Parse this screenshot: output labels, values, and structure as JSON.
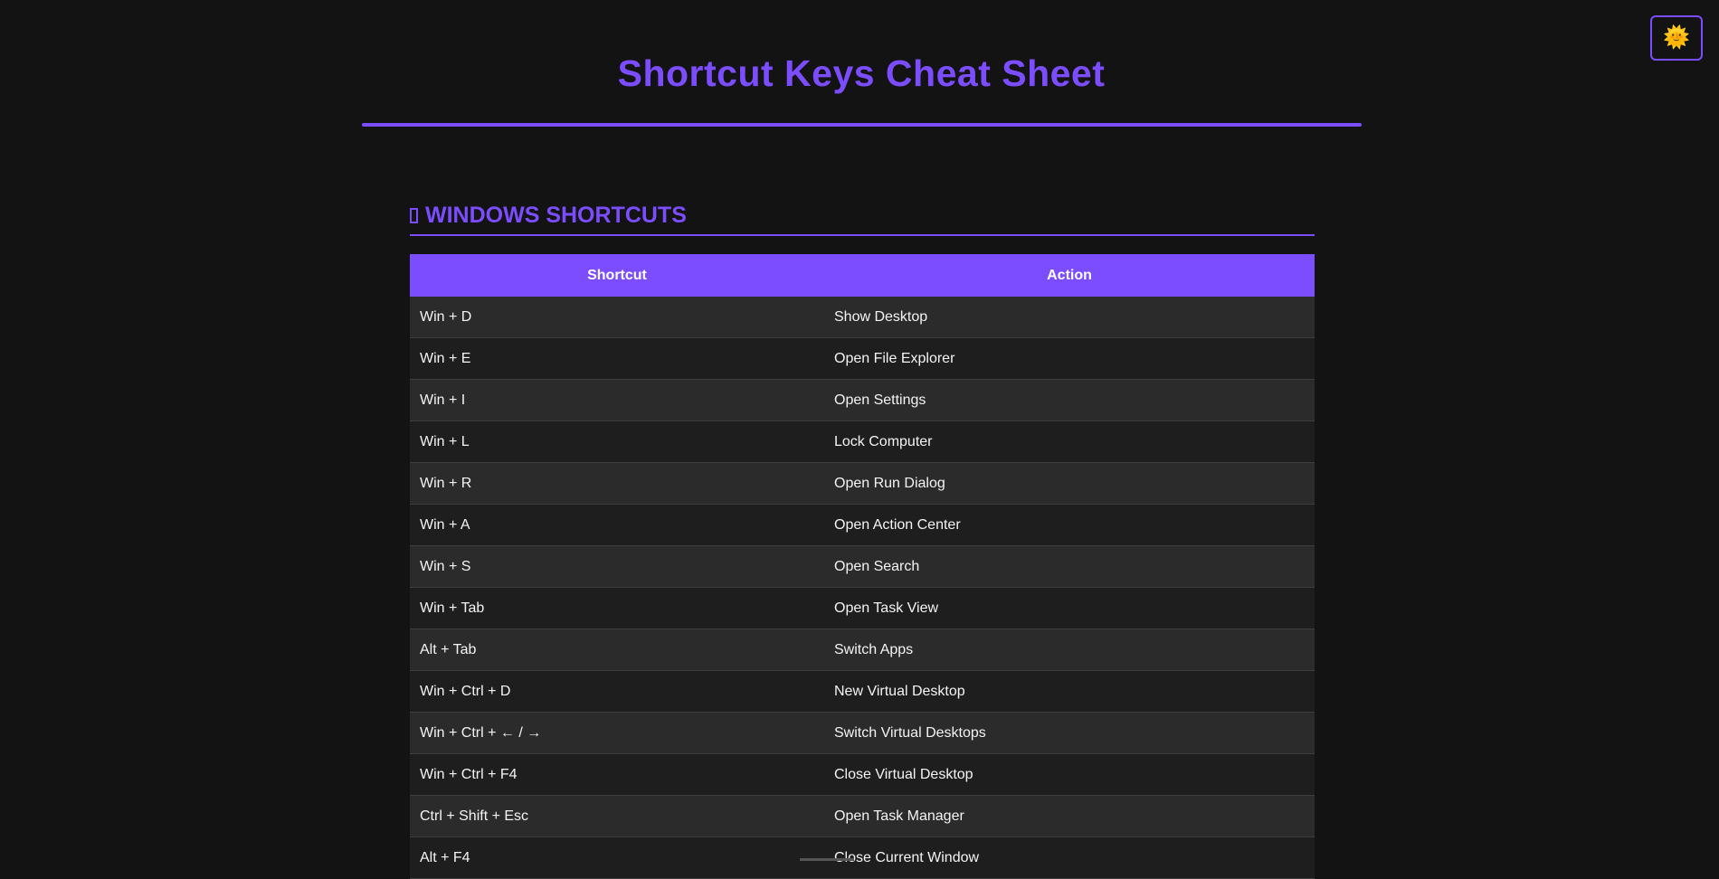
{
  "header": {
    "title": "Shortcut Keys Cheat Sheet",
    "theme_toggle_icon": "sun-icon",
    "theme_toggle_glyph": "🌞"
  },
  "section": {
    "icon": "square-outline-icon",
    "title": "WINDOWS SHORTCUTS"
  },
  "table": {
    "columns": [
      "Shortcut",
      "Action"
    ],
    "rows": [
      {
        "shortcut": "Win + D",
        "action": "Show Desktop"
      },
      {
        "shortcut": "Win + E",
        "action": "Open File Explorer"
      },
      {
        "shortcut": "Win + I",
        "action": "Open Settings"
      },
      {
        "shortcut": "Win + L",
        "action": "Lock Computer"
      },
      {
        "shortcut": "Win + R",
        "action": "Open Run Dialog"
      },
      {
        "shortcut": "Win + A",
        "action": "Open Action Center"
      },
      {
        "shortcut": "Win + S",
        "action": "Open Search"
      },
      {
        "shortcut": "Win + Tab",
        "action": "Open Task View"
      },
      {
        "shortcut": "Alt + Tab",
        "action": "Switch Apps"
      },
      {
        "shortcut": "Win + Ctrl + D",
        "action": "New Virtual Desktop"
      },
      {
        "shortcut": "Win + Ctrl + ← / →",
        "action": "Switch Virtual Desktops"
      },
      {
        "shortcut": "Win + Ctrl + F4",
        "action": "Close Virtual Desktop"
      },
      {
        "shortcut": "Ctrl + Shift + Esc",
        "action": "Open Task Manager"
      },
      {
        "shortcut": "Alt + F4",
        "action": "Close Current Window"
      }
    ]
  },
  "colors": {
    "accent": "#7b4dff",
    "background": "#131313",
    "row_odd": "#2b2b2b",
    "row_even": "#1e1e1e"
  }
}
